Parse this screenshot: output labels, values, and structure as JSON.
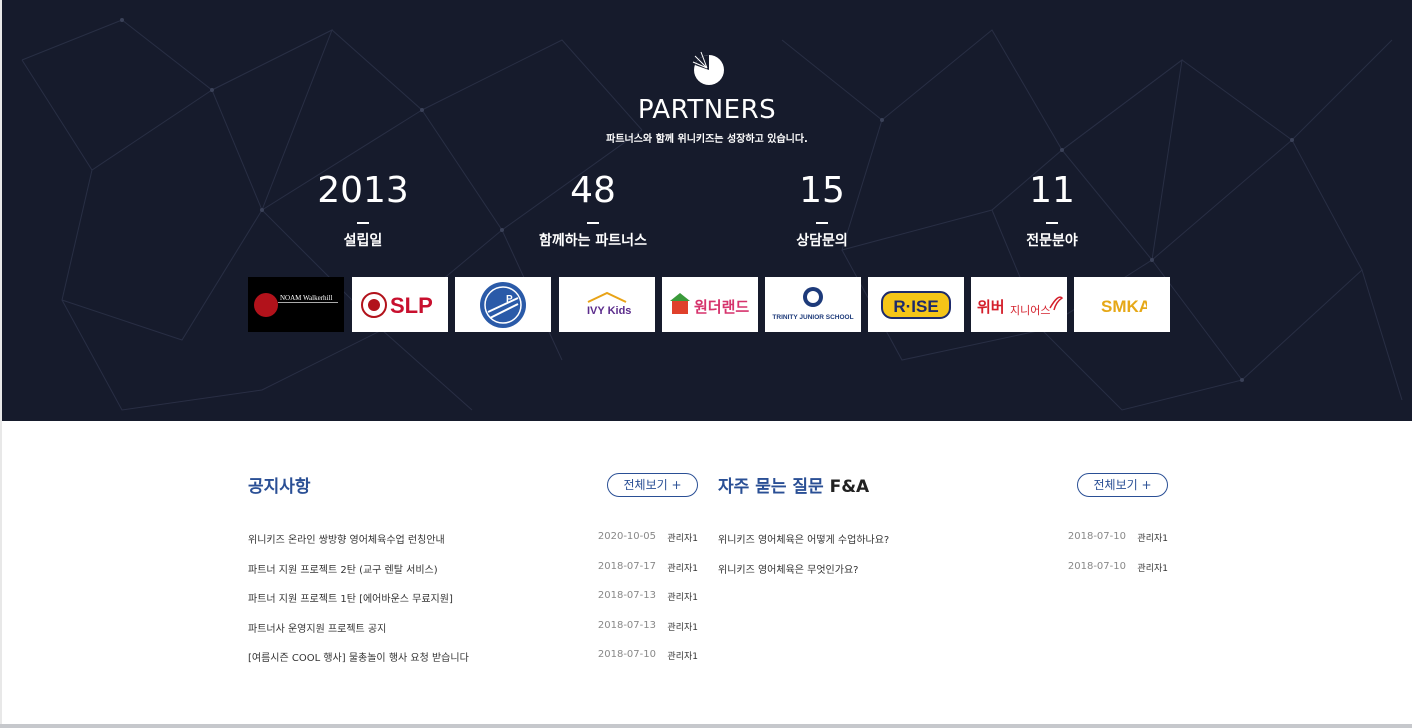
{
  "partners": {
    "title": "PARTNERS",
    "subtitle": "파트너스와 함께 위니키즈는 성장하고 있습니다.",
    "stats": [
      {
        "value": "2013",
        "label": "설립일"
      },
      {
        "value": "48",
        "label": "함께하는 파트너스"
      },
      {
        "value": "15",
        "label": "상담문의"
      },
      {
        "value": "11",
        "label": "전문분야"
      }
    ],
    "logos": [
      {
        "name": "NOAM Walkerhill",
        "icon": "noam-logo"
      },
      {
        "name": "SLP",
        "icon": "slp-logo"
      },
      {
        "name": "P",
        "icon": "p-shield-logo"
      },
      {
        "name": "IVY Kids",
        "icon": "ivy-kids-logo"
      },
      {
        "name": "원더랜드",
        "icon": "wonderland-logo"
      },
      {
        "name": "TRINITY JUNIOR SCHOOL",
        "icon": "trinity-logo"
      },
      {
        "name": "R·ISE",
        "icon": "rise-logo"
      },
      {
        "name": "위버",
        "sub": "지니어스",
        "icon": "uber-genius-logo"
      },
      {
        "name": "SMKA",
        "icon": "smka-logo"
      }
    ]
  },
  "notice": {
    "title": "공지사항",
    "more_label": "전체보기 +",
    "items": [
      {
        "title": "위니키즈 온라인 쌍방향 영어체육수업 런칭안내",
        "date": "2020-10-05",
        "author": "관리자1"
      },
      {
        "title": "파트너 지원 프로젝트 2탄 (교구 렌탈 서비스)",
        "date": "2018-07-17",
        "author": "관리자1"
      },
      {
        "title": "파트너 지원 프로젝트 1탄 [에어바운스 무료지원]",
        "date": "2018-07-13",
        "author": "관리자1"
      },
      {
        "title": "파트너사 운영지원 프로젝트 공지",
        "date": "2018-07-13",
        "author": "관리자1"
      },
      {
        "title": "[여름시즌 COOL 행사] 물총놀이 행사 요청 받습니다",
        "date": "2018-07-10",
        "author": "관리자1"
      }
    ]
  },
  "faq": {
    "title_main": "자주 묻는 질문",
    "title_suffix": " F&A",
    "more_label": "전체보기 +",
    "items": [
      {
        "title": "위니키즈 영어체육은 어떻게 수업하나요?",
        "date": "2018-07-10",
        "author": "관리자1"
      },
      {
        "title": "위니키즈 영어체육은 무엇인가요?",
        "date": "2018-07-10",
        "author": "관리자1"
      }
    ]
  },
  "colors": {
    "dark_bg": "#161b2c",
    "accent": "#2a4f95"
  }
}
